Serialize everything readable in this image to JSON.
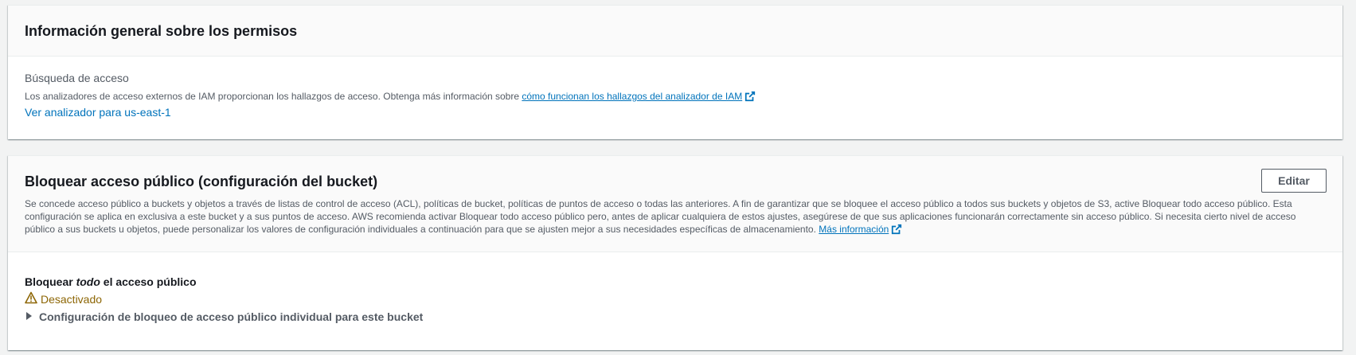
{
  "permissions_overview": {
    "title": "Información general sobre los permisos",
    "access_finding_label": "Búsqueda de acceso",
    "description_prefix": "Los analizadores de acceso externos de IAM proporcionan los hallazgos de acceso. Obtenga más información sobre ",
    "description_link": "cómo funcionan los hallazgos del analizador de IAM",
    "view_analyzer_link": "Ver analizador para us-east-1"
  },
  "block_public_access": {
    "title": "Bloquear acceso público (configuración del bucket)",
    "edit_button": "Editar",
    "description": "Se concede acceso público a buckets y objetos a través de listas de control de acceso (ACL), políticas de bucket, políticas de puntos de acceso o todas las anteriores. A fin de garantizar que se bloquee el acceso público a todos sus buckets y objetos de S3, active Bloquear todo acceso público. Esta configuración se aplica en exclusiva a este bucket y a sus puntos de acceso. AWS recomienda activar Bloquear todo acceso público pero, antes de aplicar cualquiera de estos ajustes, asegúrese de que sus aplicaciones funcionarán correctamente sin acceso público. Si necesita cierto nivel de acceso público a sus buckets u objetos, puede personalizar los valores de configuración individuales a continuación para que se ajusten mejor a sus necesidades específicas de almacenamiento.",
    "more_info_link": "Más información",
    "block_all_prefix": "Bloquear ",
    "block_all_emphasis": "todo",
    "block_all_suffix": " el acceso público",
    "status_text": "Desactivado",
    "status_icon": "warning-icon",
    "expander_label": "Configuración de bloqueo de acceso público individual para este bucket"
  },
  "colors": {
    "link": "#0073bb",
    "warning": "#8d6605",
    "text": "#16191f",
    "secondary_text": "#545b64"
  }
}
